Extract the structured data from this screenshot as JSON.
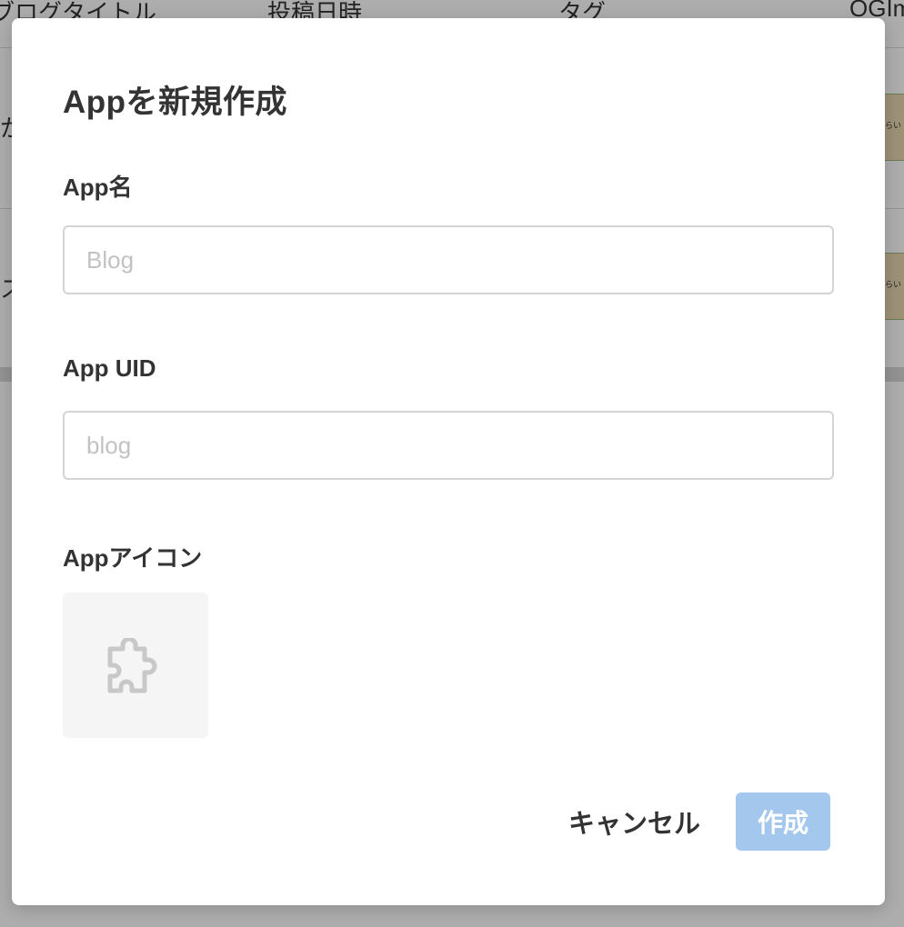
{
  "background": {
    "columns": [
      "ブログタイトル",
      "投稿日時",
      "タグ",
      "OGIm"
    ],
    "rows": [
      {
        "text": "か",
        "thumb": "らい"
      },
      {
        "text": "ス",
        "thumb": "らい"
      }
    ]
  },
  "modal": {
    "title": "Appを新規作成",
    "fields": {
      "name": {
        "label": "App名",
        "placeholder": "Blog",
        "value": ""
      },
      "uid": {
        "label": "App UID",
        "placeholder": "blog",
        "value": ""
      },
      "icon": {
        "label": "Appアイコン",
        "icon": "puzzle-icon"
      }
    },
    "cancel_label": "キャンセル",
    "create_label": "作成"
  },
  "colors": {
    "create_button_bg": "#a3c7ed",
    "overlay": "rgba(0,0,0,0.32)"
  }
}
